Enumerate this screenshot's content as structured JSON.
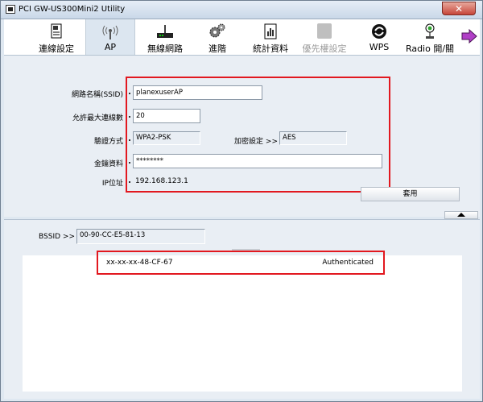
{
  "window": {
    "title": "PCI GW-US300Mini2 Utility",
    "close_label": "✕"
  },
  "toolbar": {
    "items": [
      {
        "label": "連線設定",
        "icon": "document-icon"
      },
      {
        "label": "AP",
        "icon": "ap-antenna-icon"
      },
      {
        "label": "無線網路",
        "icon": "router-icon"
      },
      {
        "label": "進階",
        "icon": "gears-icon"
      },
      {
        "label": "統計資料",
        "icon": "statistics-icon"
      },
      {
        "label": "優先權設定",
        "icon": "priority-icon"
      },
      {
        "label": "WPS",
        "icon": "wps-icon"
      },
      {
        "label": "Radio 開/關",
        "icon": "radio-power-icon"
      }
    ],
    "active": "AP",
    "disabled": "優先權設定"
  },
  "ap_settings": {
    "ssid_label": "網路名稱(SSID)",
    "ssid_value": "planexuserAP",
    "max_conn_label": "允許最大連線數",
    "max_conn_value": "20",
    "auth_label": "驗證方式",
    "auth_value": "WPA2-PSK",
    "encrypt_label": "加密設定 >>",
    "encrypt_value": "AES",
    "key_label": "金鑰資料",
    "key_value": "********",
    "ip_label": "IP位址",
    "ip_value": "192.168.123.1",
    "apply_label": "套用"
  },
  "client_list": {
    "bssid_label": "BSSID >>",
    "bssid_value": "00-90-CC-E5-81-13",
    "entries": [
      {
        "mac": "xx-xx-xx-48-CF-67",
        "status": "Authenticated"
      }
    ]
  },
  "colors": {
    "highlight": "#e2181f",
    "panel": "#e9eef4",
    "frame": "#dfe8f1"
  }
}
